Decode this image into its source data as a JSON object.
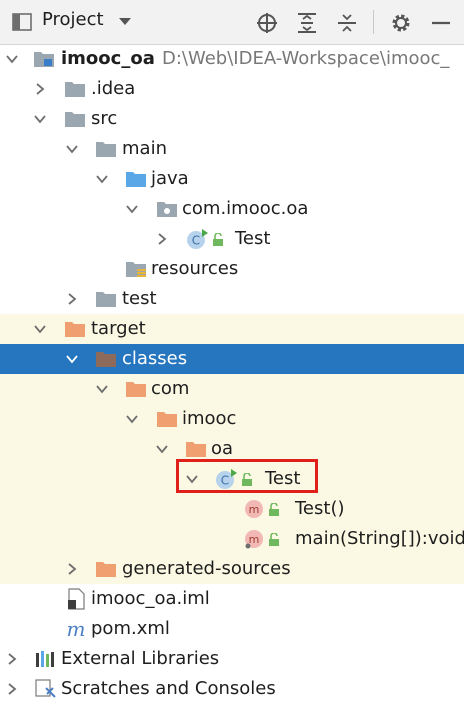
{
  "toolbar": {
    "title": "Project",
    "icons": [
      "project-view-icon",
      "dropdown-icon",
      "locate-icon",
      "expand-all-icon",
      "collapse-all-icon",
      "settings-icon",
      "hide-icon"
    ]
  },
  "tree": {
    "root_name": "imooc_oa",
    "root_path": "D:\\Web\\IDEA-Workspace\\imooc_",
    "idea": ".idea",
    "src": "src",
    "main": "main",
    "java": "java",
    "package": "com.imooc.oa",
    "test_class": "Test",
    "resources": "resources",
    "test_dir": "test",
    "target": "target",
    "classes": "classes",
    "com": "com",
    "imooc": "imooc",
    "oa": "oa",
    "compiled_class": "Test",
    "constructor": "Test()",
    "main_method": "main(String[]):void",
    "generated_sources": "generated-sources",
    "iml_file": "imooc_oa.iml",
    "pom": "pom.xml",
    "external_libraries": "External Libraries",
    "scratches": "Scratches and Consoles"
  },
  "colors": {
    "selection": "#2675bf",
    "excluded_background": "#fbf9e3",
    "highlight_box": "#e0201b",
    "folder": "#9aa7b0",
    "source_folder": "#5aa7e8",
    "excluded_folder": "#f0a070"
  }
}
